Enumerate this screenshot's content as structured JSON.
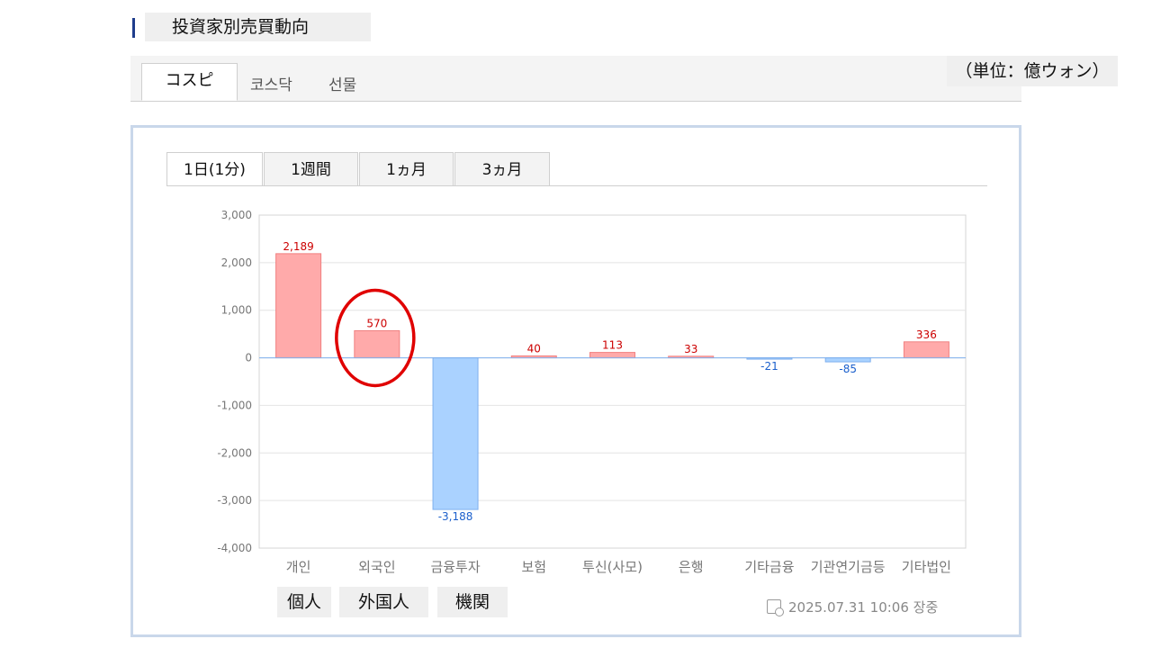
{
  "header": {
    "title": "投資家別売買動向",
    "unit": "（単位：億ウォン）"
  },
  "market_tabs": [
    {
      "label": "コスピ",
      "active": true
    },
    {
      "label": "코스닥",
      "active": false
    },
    {
      "label": "선물",
      "active": false
    }
  ],
  "period_tabs": [
    {
      "label": "1日(1分)",
      "active": true
    },
    {
      "label": "1週間",
      "active": false
    },
    {
      "label": "1ヵ月",
      "active": false
    },
    {
      "label": "3ヵ月",
      "active": false
    }
  ],
  "investor_labels": [
    "個人",
    "外国人",
    "機関"
  ],
  "timestamp": "2025.07.31 10:06 장중",
  "colors": {
    "positive_fill": "#ffaaaa",
    "positive_label": "#cc0000",
    "negative_fill": "#aad2ff",
    "negative_label": "#1a5fcc",
    "highlight": "#e00000"
  },
  "chart_data": {
    "type": "bar",
    "categories": [
      "개인",
      "외국인",
      "금융투자",
      "보험",
      "투신(사모)",
      "은행",
      "기타금융",
      "기관연기금등",
      "기타법인"
    ],
    "values": [
      2189,
      570,
      -3188,
      40,
      113,
      33,
      -21,
      -85,
      336
    ],
    "data_labels": [
      "2,189",
      "570",
      "-3,188",
      "40",
      "113",
      "33",
      "-21",
      "-85",
      "336"
    ],
    "y_ticks": [
      "3,000",
      "2,000",
      "1,000",
      "0",
      "-1,000",
      "-2,000",
      "-3,000",
      "-4,000"
    ],
    "ylim": [
      -4000,
      3000
    ],
    "grid": true,
    "highlighted_category": "외국인"
  }
}
